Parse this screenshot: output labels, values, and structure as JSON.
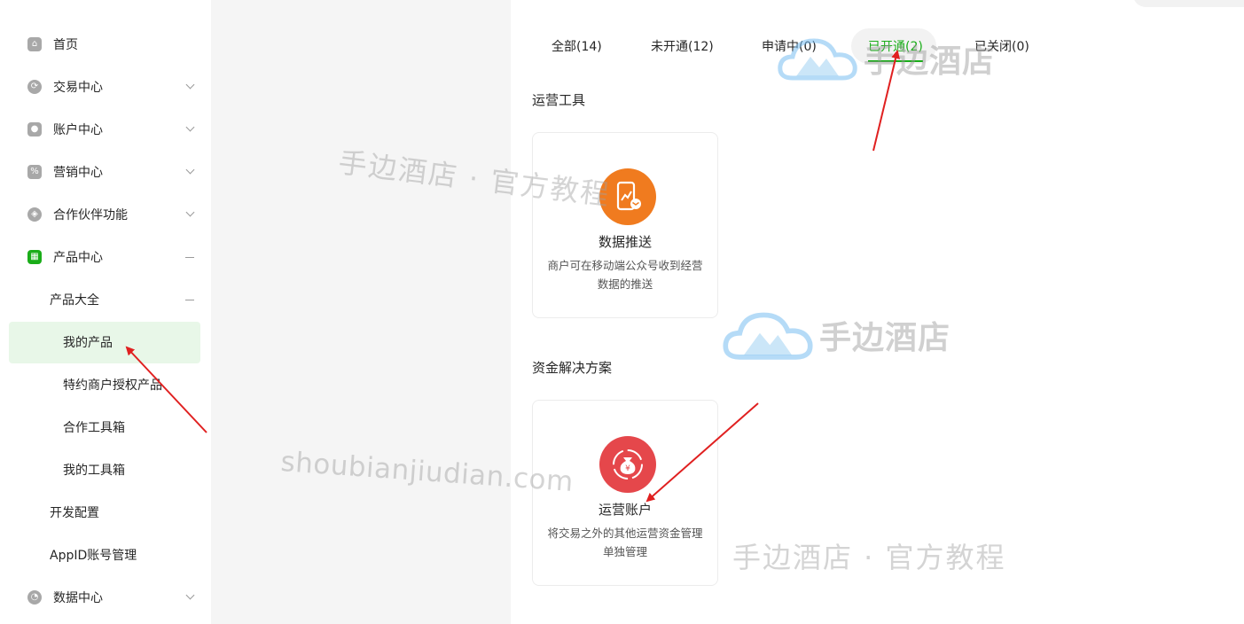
{
  "sidebar": {
    "items": [
      {
        "label": "首页"
      },
      {
        "label": "交易中心"
      },
      {
        "label": "账户中心"
      },
      {
        "label": "营销中心"
      },
      {
        "label": "合作伙伴功能"
      },
      {
        "label": "产品中心"
      },
      {
        "label": "产品大全"
      },
      {
        "label": "我的产品"
      },
      {
        "label": "特约商户授权产品"
      },
      {
        "label": "合作工具箱"
      },
      {
        "label": "我的工具箱"
      },
      {
        "label": "开发配置"
      },
      {
        "label": "AppID账号管理"
      },
      {
        "label": "数据中心"
      }
    ]
  },
  "tabs": [
    {
      "label": "全部(14)"
    },
    {
      "label": "未开通(12)"
    },
    {
      "label": "申请中(0)"
    },
    {
      "label": "已开通(2)"
    },
    {
      "label": "已关闭(0)"
    }
  ],
  "sections": [
    {
      "title": "运营工具",
      "card": {
        "title": "数据推送",
        "desc": "商户可在移动端公众号收到经营数据的推送",
        "icon": "chart-phone-icon",
        "color": "#f07b1f"
      }
    },
    {
      "title": "资金解决方案",
      "card": {
        "title": "运营账户",
        "desc": "将交易之外的其他运营资金管理单独管理",
        "icon": "money-bag-icon",
        "color": "#e5474b"
      }
    }
  ],
  "watermarks": {
    "text1": "手边酒店 · 官方教程",
    "text2": "shoubianjiudian.com",
    "text3": "手边酒店 · 官方教程",
    "brand1": "手边酒店",
    "brand2": "手边酒店"
  },
  "colors": {
    "accent": "#1aad19",
    "annotation_arrow": "#e02020"
  }
}
